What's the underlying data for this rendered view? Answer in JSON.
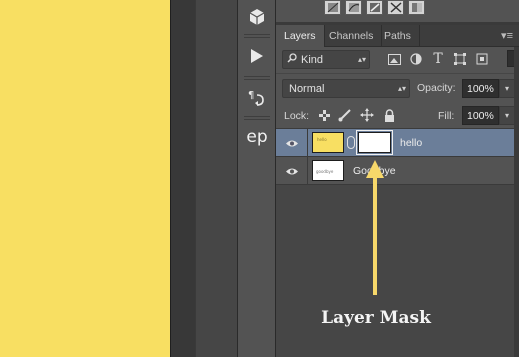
{
  "tool_column": {
    "items": [
      {
        "icon": "cube-icon"
      },
      {
        "icon": "play-icon"
      },
      {
        "icon": "paragraph-icon",
        "text": "¶"
      },
      {
        "text": "ep"
      }
    ]
  },
  "adjustments": {
    "icons": [
      "adjust-1-icon",
      "adjust-2-icon",
      "adjust-3-icon",
      "adjust-4-icon",
      "adjust-5-icon"
    ]
  },
  "tabs": [
    {
      "label": "Layers",
      "active": true
    },
    {
      "label": "Channels",
      "active": false
    },
    {
      "label": "Paths",
      "active": false
    }
  ],
  "filter": {
    "kind_label": "Kind",
    "icons": [
      "image-filter-icon",
      "adjustment-filter-icon",
      "text-filter-icon",
      "shape-filter-icon",
      "smart-object-filter-icon"
    ]
  },
  "blend": {
    "mode": "Normal",
    "opacity_label": "Opacity:",
    "opacity_value": "100%"
  },
  "lock": {
    "label": "Lock:",
    "fill_label": "Fill:",
    "fill_value": "100%"
  },
  "layers": [
    {
      "name": "hello",
      "selected": true,
      "thumb_color": "#f8df62",
      "has_mask": true,
      "visible": true
    },
    {
      "name": "Goodbye",
      "selected": false,
      "thumb_color": "#ffffff",
      "has_mask": false,
      "visible": true
    }
  ],
  "annotation": {
    "label": "Layer Mask",
    "arrow_color": "#f7d86a"
  },
  "colors": {
    "canvas": "#f8df62",
    "selected_layer": "#6b7e99",
    "panel": "#535353"
  }
}
